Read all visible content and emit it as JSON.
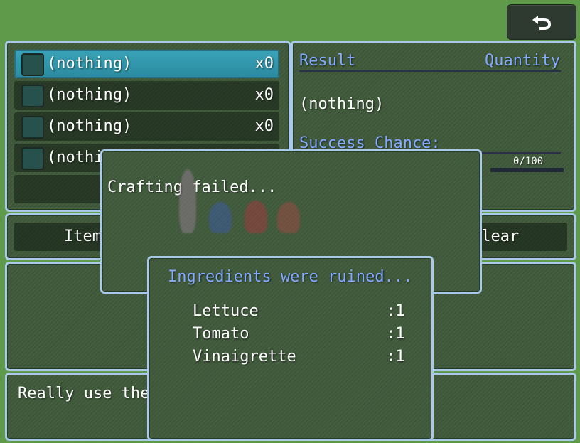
{
  "back_button": {
    "icon": "return-arrow-icon"
  },
  "item_list": {
    "rows": [
      {
        "name": "(nothing)",
        "count": "x0"
      },
      {
        "name": "(nothing)",
        "count": "x0"
      },
      {
        "name": "(nothing)",
        "count": "x0"
      },
      {
        "name": "(nothi",
        "count": ""
      }
    ]
  },
  "result_panel": {
    "result_header": "Result",
    "quantity_header": "Quantity",
    "result_value": "(nothing)",
    "success_label": "Success Chance:",
    "gauge_text": "0/100",
    "gauge_fill": 0
  },
  "command_bar": {
    "item_label": "Item",
    "clear_label": "Clear"
  },
  "help": {
    "text": "Really use the"
  },
  "popup_failed": {
    "message": "Crafting failed..."
  },
  "popup_ruined": {
    "title": "Ingredients were ruined...",
    "ingredients": [
      {
        "name": "Lettuce",
        "qty": ":1"
      },
      {
        "name": "Tomato",
        "qty": ":1"
      },
      {
        "name": "Vinaigrette",
        "qty": ":1"
      }
    ]
  },
  "colors": {
    "system_blue": "#84aaff",
    "border": "#a9c9e8",
    "selected": "#3aa3b8"
  }
}
